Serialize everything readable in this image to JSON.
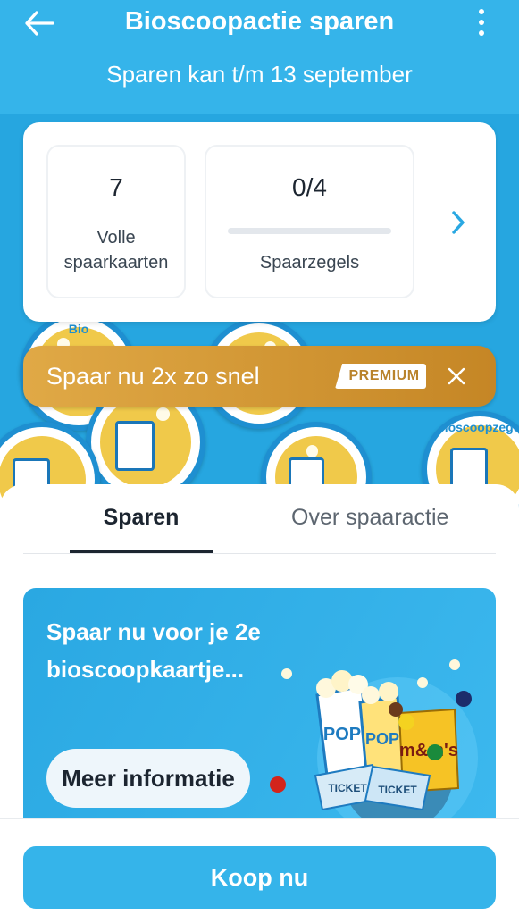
{
  "header": {
    "title": "Bioscoopactie sparen",
    "subtitle": "Sparen kan t/m 13 september",
    "back_icon": "arrow-left-icon",
    "menu_icon": "more-vertical-icon"
  },
  "stats": {
    "full_cards": {
      "value": "7",
      "label": "Volle spaarkaarten"
    },
    "stamps": {
      "value": "0/4",
      "label": "Spaarzegels",
      "progress": 0
    },
    "next_icon": "chevron-right-icon"
  },
  "stamp_decor": {
    "label_a": "Bio",
    "label_b": "Bioscoopzegel"
  },
  "premium": {
    "text": "Spaar nu 2x zo snel",
    "badge": "PREMIUM",
    "close_icon": "close-icon"
  },
  "tabs": [
    {
      "label": "Sparen",
      "active": true
    },
    {
      "label": "Over spaaractie",
      "active": false
    }
  ],
  "promo": {
    "text": "Spaar nu voor je 2e bioscoopkaartje...",
    "button": "Meer informatie",
    "art_labels": {
      "pop": "POP",
      "mms": "m&m's",
      "ticket": "TICKET"
    }
  },
  "footer": {
    "buy_label": "Koop nu"
  },
  "colors": {
    "primary_blue": "#35b4ea",
    "premium_gold": "#d49a36",
    "text_dark": "#1c2530"
  }
}
